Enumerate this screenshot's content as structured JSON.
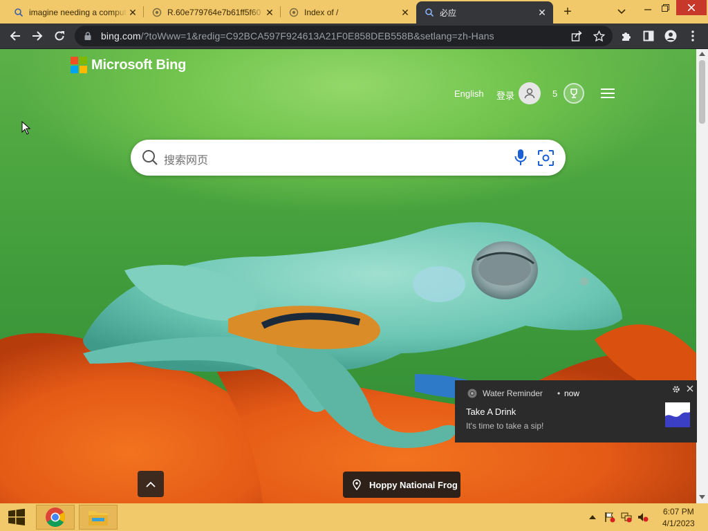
{
  "browser": {
    "tabs": [
      {
        "title": "imagine needing a computer",
        "active": false,
        "icon": "search-favicon"
      },
      {
        "title": "R.60e779764e7b61ff5f60",
        "active": false,
        "icon": "globe-favicon"
      },
      {
        "title": "Index of /",
        "active": false,
        "icon": "globe-favicon"
      },
      {
        "title": "必应",
        "active": true,
        "icon": "search-favicon"
      }
    ],
    "new_tab": "+",
    "url_host": "bing.com",
    "url_rest": "/?toWww=1&redig=C92BCA597F924613A21F0E858DEB558B&setlang=zh-Hans"
  },
  "bing": {
    "logo_text": "Microsoft Bing",
    "language_link": "English",
    "signin_label": "登录",
    "rewards_count": "5",
    "search_placeholder": "搜索网页",
    "location_label": "Hoppy National Frog"
  },
  "notification": {
    "app": "Water Reminder",
    "time": "now",
    "title": "Take A Drink",
    "body": "It's time to take a sip!"
  },
  "taskbar": {
    "time": "6:07 PM",
    "date": "4/1/2023"
  },
  "colors": {
    "tab_strip": "#f1c86a",
    "toolbar": "#35363a",
    "omnibox": "#202124",
    "bing_mic": "#1a5fd6"
  }
}
